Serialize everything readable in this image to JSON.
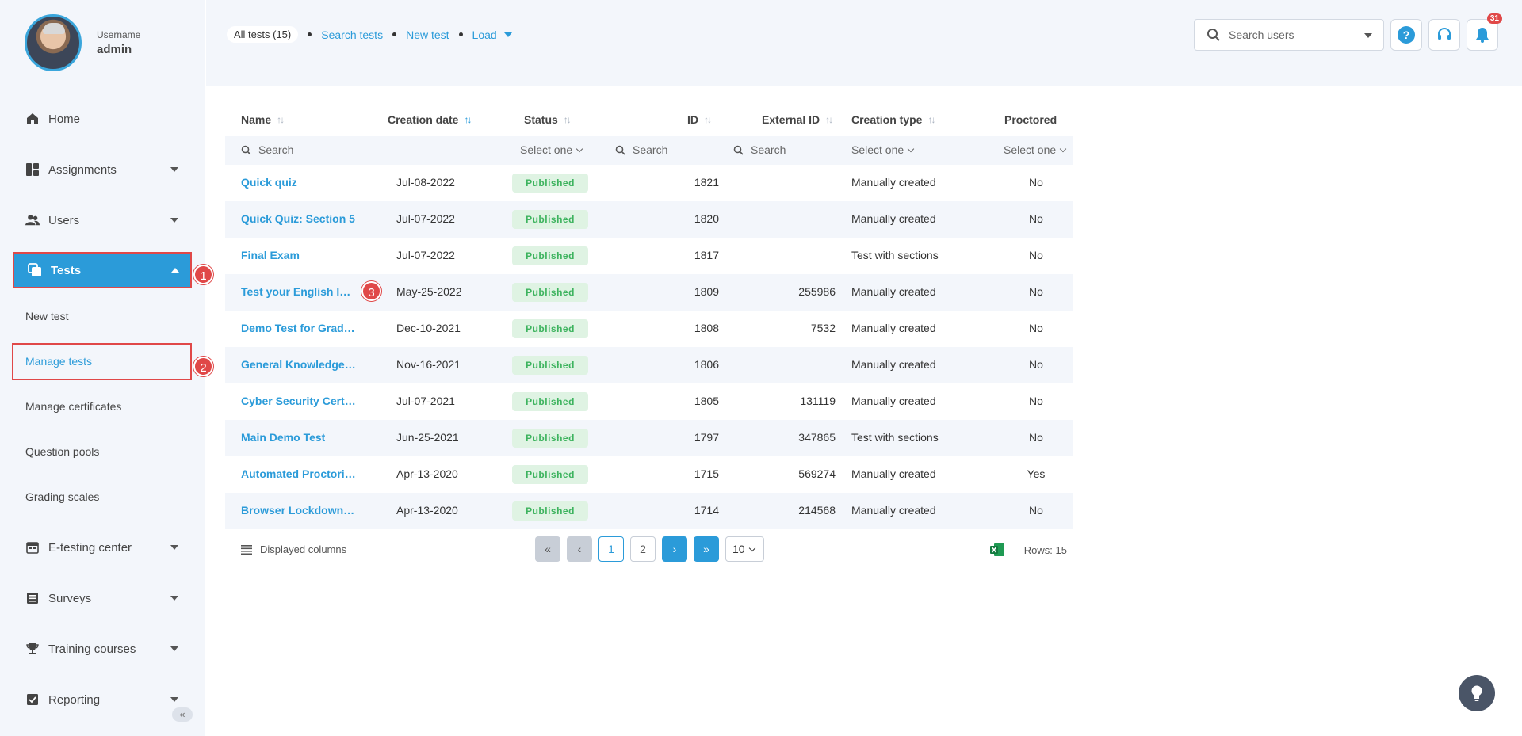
{
  "profile": {
    "caption": "Username",
    "name": "admin"
  },
  "sidebar": {
    "items": [
      {
        "label": "Home"
      },
      {
        "label": "Assignments"
      },
      {
        "label": "Users"
      },
      {
        "label": "Tests"
      },
      {
        "label": "E-testing center"
      },
      {
        "label": "Surveys"
      },
      {
        "label": "Training courses"
      },
      {
        "label": "Reporting"
      }
    ],
    "tests_sub": [
      {
        "label": "New test"
      },
      {
        "label": "Manage tests"
      },
      {
        "label": "Manage certificates"
      },
      {
        "label": "Question pools"
      },
      {
        "label": "Grading scales"
      }
    ],
    "collapse": "«"
  },
  "callouts": [
    "1",
    "2",
    "3"
  ],
  "topbar": {
    "all_tests": "All tests (15)",
    "search_tests": "Search tests",
    "new_test": "New test",
    "load": "Load",
    "user_search_placeholder": "Search users",
    "help": "?",
    "notifications_count": "31"
  },
  "table": {
    "columns": [
      "Name",
      "Creation date",
      "Status",
      "ID",
      "External ID",
      "Creation type",
      "Proctored"
    ],
    "filters": {
      "search": "Search",
      "select": "Select one"
    },
    "rows": [
      {
        "name": "Quick quiz",
        "date": "Jul-08-2022",
        "status": "Published",
        "id": "1821",
        "ext": "",
        "type": "Manually created",
        "proctored": "No"
      },
      {
        "name": "Quick Quiz: Section 5",
        "date": "Jul-07-2022",
        "status": "Published",
        "id": "1820",
        "ext": "",
        "type": "Manually created",
        "proctored": "No"
      },
      {
        "name": "Final Exam",
        "date": "Jul-07-2022",
        "status": "Published",
        "id": "1817",
        "ext": "",
        "type": "Test with sections",
        "proctored": "No"
      },
      {
        "name": "Test your English level",
        "date": "May-25-2022",
        "status": "Published",
        "id": "1809",
        "ext": "255986",
        "type": "Manually created",
        "proctored": "No"
      },
      {
        "name": "Demo Test for Grading",
        "date": "Dec-10-2021",
        "status": "Published",
        "id": "1808",
        "ext": "7532",
        "type": "Manually created",
        "proctored": "No"
      },
      {
        "name": "General Knowledge T...",
        "date": "Nov-16-2021",
        "status": "Published",
        "id": "1806",
        "ext": "",
        "type": "Manually created",
        "proctored": "No"
      },
      {
        "name": "Cyber Security Certifi...",
        "date": "Jul-07-2021",
        "status": "Published",
        "id": "1805",
        "ext": "131119",
        "type": "Manually created",
        "proctored": "No"
      },
      {
        "name": "Main Demo Test",
        "date": "Jun-25-2021",
        "status": "Published",
        "id": "1797",
        "ext": "347865",
        "type": "Test with sections",
        "proctored": "No"
      },
      {
        "name": "Automated Proctorin...",
        "date": "Apr-13-2020",
        "status": "Published",
        "id": "1715",
        "ext": "569274",
        "type": "Manually created",
        "proctored": "Yes"
      },
      {
        "name": "Browser Lockdown D...",
        "date": "Apr-13-2020",
        "status": "Published",
        "id": "1714",
        "ext": "214568",
        "type": "Manually created",
        "proctored": "No"
      }
    ]
  },
  "footer": {
    "displayed_columns": "Displayed columns",
    "pages": [
      "1",
      "2"
    ],
    "page_size": "10",
    "rows": "Rows: 15"
  },
  "colors": {
    "accent": "#2b9bd9",
    "highlight": "#e04848",
    "published_bg": "#dff3e3",
    "published_fg": "#3db35e"
  }
}
